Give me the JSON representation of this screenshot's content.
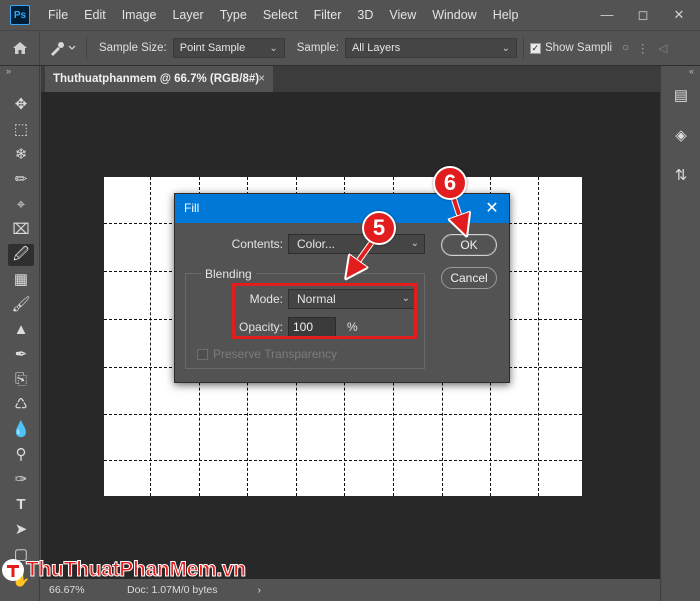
{
  "app": {
    "logo": "Ps",
    "menu": [
      "File",
      "Edit",
      "Image",
      "Layer",
      "Type",
      "Select",
      "Filter",
      "3D",
      "View",
      "Window",
      "Help"
    ],
    "window_controls": [
      "minimize-icon",
      "maximize-icon",
      "close-icon"
    ]
  },
  "options_bar": {
    "sample_size_label": "Sample Size:",
    "sample_size_value": "Point Sample",
    "sample_label": "Sample:",
    "sample_value": "All Layers",
    "show_sampling_label": "Show Sampli",
    "show_sampling_checked": true
  },
  "document": {
    "tab_title": "Thuthuatphanmem @ 66.7% (RGB/8#)",
    "tab_close": "×"
  },
  "status": {
    "zoom": "66.67%",
    "doc": "Doc: 1.07M/0 bytes",
    "arrow": "›"
  },
  "dialog": {
    "title": "Fill",
    "close": "✕",
    "contents_label": "Contents:",
    "contents_value": "Color...",
    "ok_label": "OK",
    "cancel_label": "Cancel",
    "blending_label": "Blending",
    "mode_label": "Mode:",
    "mode_value": "Normal",
    "opacity_label": "Opacity:",
    "opacity_value": "100",
    "opacity_unit": "%",
    "preserve_label": "Preserve Transparency",
    "preserve_checked": false
  },
  "annotations": {
    "step5": "5",
    "step6": "6",
    "color": "#e11d1d"
  },
  "watermark": {
    "text": "ThuThuatPhanMem.vn"
  },
  "tools": [
    "move-tool-icon",
    "marquee-tool-icon",
    "lasso-tool-icon",
    "quick-select-tool-icon",
    "crop-tool-icon",
    "frame-tool-icon",
    "eyedropper-tool-icon",
    "healing-brush-tool-icon",
    "brush-tool-icon",
    "clone-stamp-tool-icon",
    "history-brush-tool-icon",
    "eraser-tool-icon",
    "paint-bucket-tool-icon",
    "blur-tool-icon",
    "dodge-tool-icon",
    "pen-tool-icon",
    "type-tool-icon",
    "path-select-tool-icon",
    "shape-tool-icon",
    "hand-tool-icon"
  ]
}
